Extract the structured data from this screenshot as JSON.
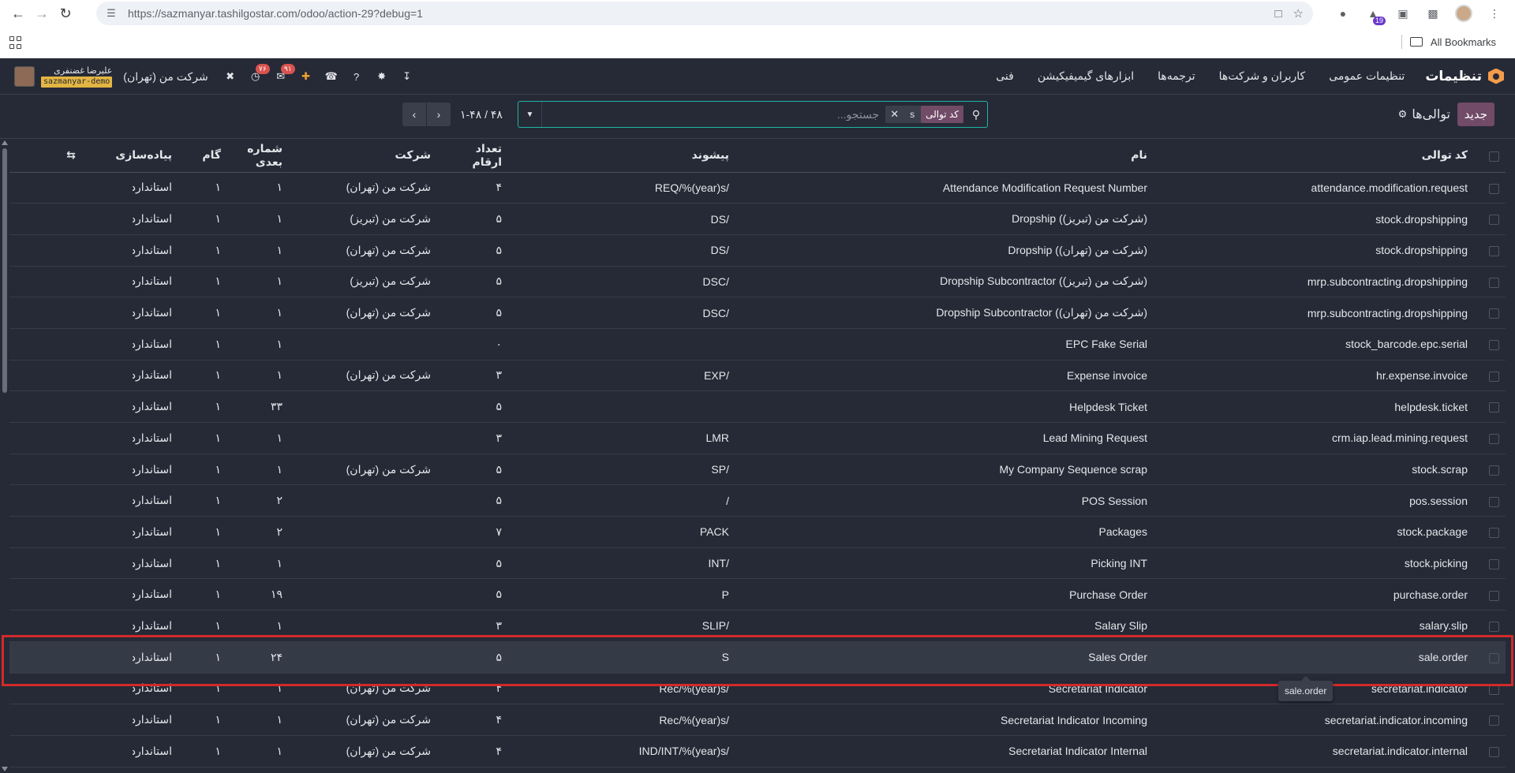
{
  "browser": {
    "url": "https://sazmanyar.tashilgostar.com/odoo/action-29?debug=1",
    "bookmarks_label": "All Bookmarks",
    "extension_badge": "19"
  },
  "navbar": {
    "app_title": "تنظیمات",
    "menu": [
      "تنظیمات عمومی",
      "کاربران و شرکت‌ها",
      "ترجمه‌ها",
      "ابزارهای گیمیفیکیشن",
      "فنی"
    ],
    "company": "شرکت من (تهران)",
    "user_name": "علیرضا غضنفری",
    "db_name": "sazmanyar-demo",
    "messages_badge": "۹۱",
    "activity_badge": "۷۶"
  },
  "control_panel": {
    "new_button": "جدید",
    "breadcrumb": "توالی‌ها",
    "facet_label": "کد توالی",
    "facet_value": "s",
    "search_placeholder": "جستجو...",
    "pager_value": "۱-۴۸ / ۴۸"
  },
  "table": {
    "headers": {
      "code": "کد توالی",
      "name": "نام",
      "prefix": "پیشوند",
      "padding": "تعداد ارقام",
      "company": "شرکت",
      "next_number": "شماره بعدی",
      "step": "گام",
      "implementation": "پیاده‌سازی"
    },
    "rows": [
      {
        "code": "attendance.modification.request",
        "name": "Attendance Modification Request Number",
        "prefix": "REQ/%(year)s/",
        "padding": "۴",
        "company": "شرکت من (تهران)",
        "next_number": "۱",
        "step": "۱",
        "implementation": "استاندارد"
      },
      {
        "code": "stock.dropshipping",
        "name": "Dropship (شرکت من (تبریز))",
        "prefix": "DS/",
        "padding": "۵",
        "company": "شرکت من (تبریز)",
        "next_number": "۱",
        "step": "۱",
        "implementation": "استاندارد"
      },
      {
        "code": "stock.dropshipping",
        "name": "Dropship (شرکت من (تهران))",
        "prefix": "DS/",
        "padding": "۵",
        "company": "شرکت من (تهران)",
        "next_number": "۱",
        "step": "۱",
        "implementation": "استاندارد"
      },
      {
        "code": "mrp.subcontracting.dropshipping",
        "name": "Dropship Subcontractor (شرکت من (تبریز))",
        "prefix": "DSC/",
        "padding": "۵",
        "company": "شرکت من (تبریز)",
        "next_number": "۱",
        "step": "۱",
        "implementation": "استاندارد"
      },
      {
        "code": "mrp.subcontracting.dropshipping",
        "name": "Dropship Subcontractor (شرکت من (تهران))",
        "prefix": "DSC/",
        "padding": "۵",
        "company": "شرکت من (تهران)",
        "next_number": "۱",
        "step": "۱",
        "implementation": "استاندارد"
      },
      {
        "code": "stock_barcode.epc.serial",
        "name": "EPC Fake Serial",
        "prefix": "",
        "padding": "۰",
        "company": "",
        "next_number": "۱",
        "step": "۱",
        "implementation": "استاندارد"
      },
      {
        "code": "hr.expense.invoice",
        "name": "Expense invoice",
        "prefix": "EXP/",
        "padding": "۳",
        "company": "شرکت من (تهران)",
        "next_number": "۱",
        "step": "۱",
        "implementation": "استاندارد"
      },
      {
        "code": "helpdesk.ticket",
        "name": "Helpdesk Ticket",
        "prefix": "",
        "padding": "۵",
        "company": "",
        "next_number": "۳۳",
        "step": "۱",
        "implementation": "استاندارد"
      },
      {
        "code": "crm.iap.lead.mining.request",
        "name": "Lead Mining Request",
        "prefix": "LMR",
        "padding": "۳",
        "company": "",
        "next_number": "۱",
        "step": "۱",
        "implementation": "استاندارد"
      },
      {
        "code": "stock.scrap",
        "name": "My Company Sequence scrap",
        "prefix": "SP/",
        "padding": "۵",
        "company": "شرکت من (تهران)",
        "next_number": "۱",
        "step": "۱",
        "implementation": "استاندارد"
      },
      {
        "code": "pos.session",
        "name": "POS Session",
        "prefix": "/",
        "padding": "۵",
        "company": "",
        "next_number": "۲",
        "step": "۱",
        "implementation": "استاندارد"
      },
      {
        "code": "stock.package",
        "name": "Packages",
        "prefix": "PACK",
        "padding": "۷",
        "company": "",
        "next_number": "۲",
        "step": "۱",
        "implementation": "استاندارد"
      },
      {
        "code": "stock.picking",
        "name": "Picking INT",
        "prefix": "INT/",
        "padding": "۵",
        "company": "",
        "next_number": "۱",
        "step": "۱",
        "implementation": "استاندارد"
      },
      {
        "code": "purchase.order",
        "name": "Purchase Order",
        "prefix": "P",
        "padding": "۵",
        "company": "",
        "next_number": "۱۹",
        "step": "۱",
        "implementation": "استاندارد"
      },
      {
        "code": "salary.slip",
        "name": "Salary Slip",
        "prefix": "SLIP/",
        "padding": "۳",
        "company": "",
        "next_number": "۱",
        "step": "۱",
        "implementation": "استاندارد"
      },
      {
        "code": "sale.order",
        "name": "Sales Order",
        "prefix": "S",
        "padding": "۵",
        "company": "",
        "next_number": "۲۴",
        "step": "۱",
        "implementation": "استاندارد"
      },
      {
        "code": "secretariat.indicator",
        "name": "Secretariat Indicator",
        "prefix": "Rec/%(year)s/",
        "padding": "۴",
        "company": "شرکت من (تهران)",
        "next_number": "۱",
        "step": "۱",
        "implementation": "استاندارد"
      },
      {
        "code": "secretariat.indicator.incoming",
        "name": "Secretariat Indicator Incoming",
        "prefix": "Rec/%(year)s/",
        "padding": "۴",
        "company": "شرکت من (تهران)",
        "next_number": "۱",
        "step": "۱",
        "implementation": "استاندارد"
      },
      {
        "code": "secretariat.indicator.internal",
        "name": "Secretariat Indicator Internal",
        "prefix": "IND/INT/%(year)s/",
        "padding": "۴",
        "company": "شرکت من (تهران)",
        "next_number": "۱",
        "step": "۱",
        "implementation": "استاندارد"
      }
    ],
    "highlighted_row_index": 15
  },
  "tooltip": {
    "text": "sale.order"
  },
  "colors": {
    "background": "#262a36",
    "brand": "#714b67",
    "accent": "#22b3a6",
    "highlight_border": "#d12a2a",
    "badge": "#d9534f"
  }
}
